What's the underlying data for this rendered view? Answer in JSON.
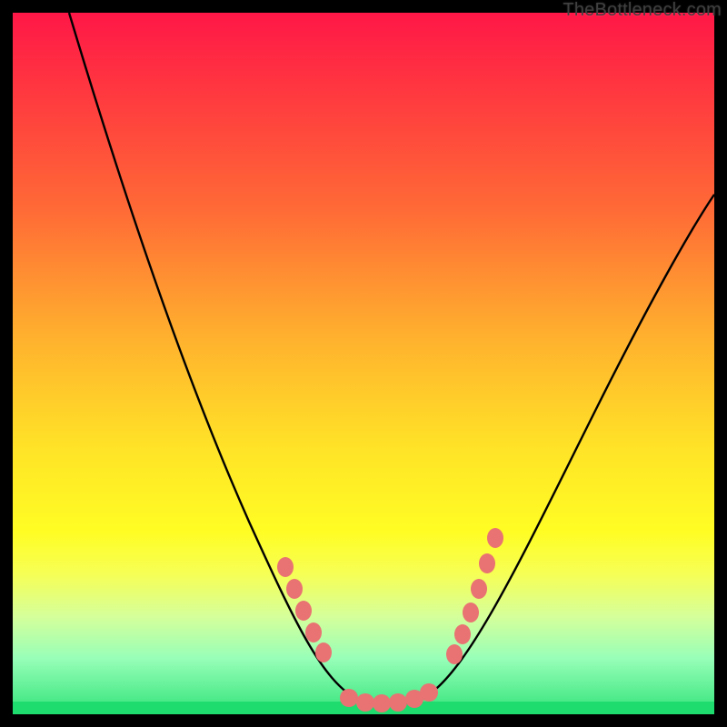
{
  "watermark": "TheBottleneck.com",
  "chart_data": {
    "type": "line",
    "title": "",
    "xlabel": "",
    "ylabel": "",
    "xlim": [
      0,
      100
    ],
    "ylim": [
      0,
      100
    ],
    "series": [
      {
        "name": "bottleneck-curve",
        "x": [
          8,
          12,
          16,
          20,
          24,
          28,
          32,
          36,
          40,
          43,
          46,
          49,
          52,
          56,
          60,
          64,
          68,
          72,
          76,
          80,
          84,
          88,
          92,
          96,
          100
        ],
        "y": [
          100,
          88,
          76,
          65,
          55,
          46,
          38,
          30,
          22,
          15,
          9,
          4,
          2,
          2,
          4,
          9,
          15,
          22,
          29,
          36,
          43,
          49,
          55,
          60,
          65
        ]
      }
    ],
    "markers": {
      "left_cluster": {
        "x": [
          40,
          41,
          42.5,
          44,
          45.5
        ],
        "y": [
          22,
          19,
          16,
          13,
          10
        ]
      },
      "bottom_cluster": {
        "x": [
          48,
          50,
          52,
          54,
          56,
          58
        ],
        "y": [
          2,
          2,
          2,
          2,
          2,
          2
        ]
      },
      "right_cluster": {
        "x": [
          62,
          63,
          64,
          65.5,
          67,
          68
        ],
        "y": [
          8,
          10,
          13,
          17,
          21,
          25
        ]
      }
    },
    "gradient_stops": [
      {
        "pos": 0,
        "color": "#ff1747"
      },
      {
        "pos": 12,
        "color": "#ff3a3f"
      },
      {
        "pos": 28,
        "color": "#ff6a36"
      },
      {
        "pos": 46,
        "color": "#ffb02e"
      },
      {
        "pos": 62,
        "color": "#ffe327"
      },
      {
        "pos": 74,
        "color": "#fffd24"
      },
      {
        "pos": 80,
        "color": "#f6ff55"
      },
      {
        "pos": 86,
        "color": "#d6ff9a"
      },
      {
        "pos": 92,
        "color": "#98ffb8"
      },
      {
        "pos": 100,
        "color": "#32e37a"
      }
    ],
    "marker_color": "#e97272",
    "curve_color": "#000000"
  }
}
